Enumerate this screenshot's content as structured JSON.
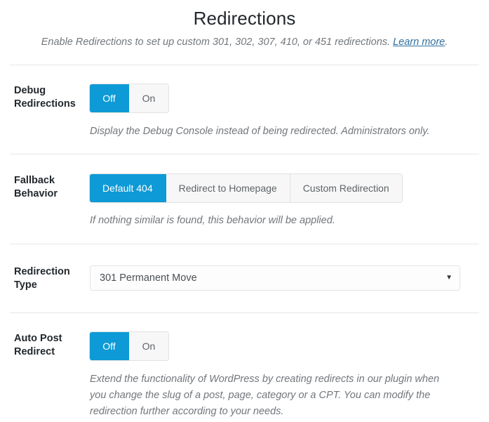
{
  "header": {
    "title": "Redirections",
    "subtitle_before": "Enable Redirections to set up custom 301, 302, 307, 410, or 451 redirections.",
    "link_label": "Learn more",
    "subtitle_after": "."
  },
  "colors": {
    "accent": "#0d9ad6",
    "text": "#23282d",
    "muted": "#72777c",
    "link": "#2f6f9f",
    "button_bg": "#f7f7f7",
    "border": "#e2e2e2",
    "divider": "#e7e7e7"
  },
  "rows": [
    {
      "label": "Debug Redirections",
      "control": "toggle",
      "options": [
        "Off",
        "On"
      ],
      "selected": "Off",
      "description": "Display the Debug Console instead of being redirected. Administrators only."
    },
    {
      "label": "Fallback Behavior",
      "control": "segmented",
      "options": [
        "Default 404",
        "Redirect to Homepage",
        "Custom Redirection"
      ],
      "selected": "Default 404",
      "description": "If nothing similar is found, this behavior will be applied."
    },
    {
      "label": "Redirection Type",
      "control": "select",
      "selected": "301 Permanent Move",
      "arrow": "▼",
      "description": ""
    },
    {
      "label": "Auto Post Redirect",
      "control": "toggle",
      "options": [
        "Off",
        "On"
      ],
      "selected": "Off",
      "description": "Extend the functionality of WordPress by creating redirects in our plugin when you change the slug of a post, page, category or a CPT. You can modify the redirection further according to your needs."
    }
  ]
}
